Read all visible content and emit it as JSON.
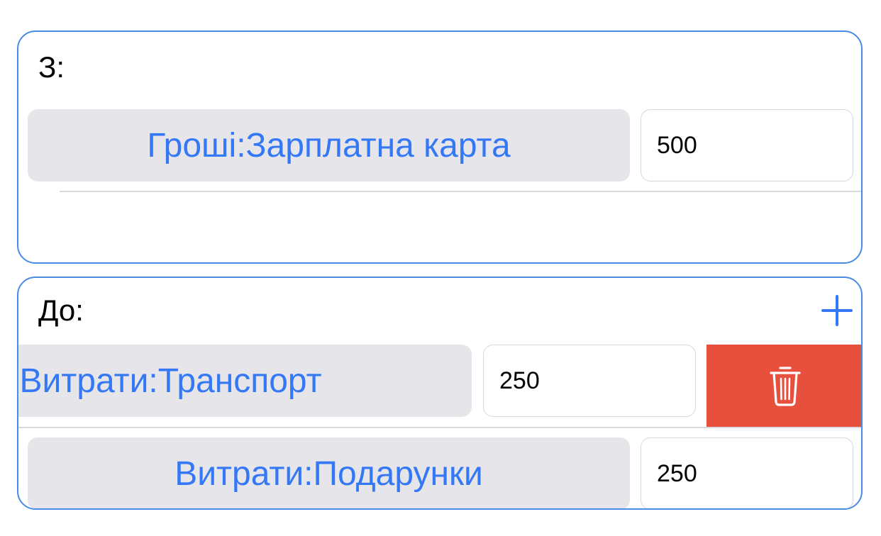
{
  "from_section": {
    "label": "З:",
    "rows": [
      {
        "account": "Гроші:Зарплатна карта",
        "amount": "500"
      }
    ]
  },
  "to_section": {
    "label": "До:",
    "rows": [
      {
        "account": "Витрати:Транспорт",
        "amount": "250"
      },
      {
        "account": "Витрати:Подарунки",
        "amount": "250"
      }
    ]
  },
  "colors": {
    "accent": "#3478f6",
    "card_border": "#4a8be6",
    "delete": "#e8503e",
    "button_bg": "#e5e5ea"
  },
  "icons": {
    "add": "plus-icon",
    "delete": "trash-icon"
  }
}
